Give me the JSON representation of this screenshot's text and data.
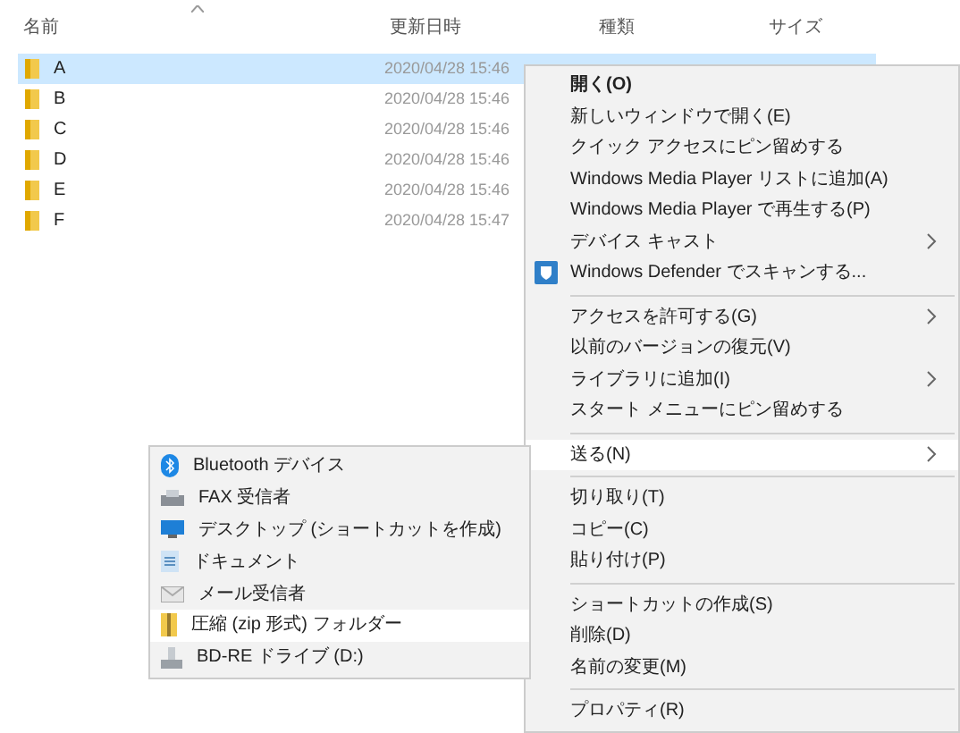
{
  "file_list": {
    "columns": [
      "名前",
      "更新日時",
      "種類",
      "サイズ"
    ],
    "rows": [
      {
        "name": "A",
        "modified": "2020/04/28 15:46",
        "selected": true
      },
      {
        "name": "B",
        "modified": "2020/04/28 15:46",
        "selected": false
      },
      {
        "name": "C",
        "modified": "2020/04/28 15:46",
        "selected": false
      },
      {
        "name": "D",
        "modified": "2020/04/28 15:46",
        "selected": false
      },
      {
        "name": "E",
        "modified": "2020/04/28 15:46",
        "selected": false
      },
      {
        "name": "F",
        "modified": "2020/04/28 15:47",
        "selected": false
      }
    ]
  },
  "context_menu": {
    "items": [
      {
        "kind": "item",
        "label": "開く(O)",
        "bold": true,
        "submenu": false,
        "selected": false
      },
      {
        "kind": "item",
        "label": "新しいウィンドウで開く(E)",
        "bold": false,
        "submenu": false,
        "selected": false
      },
      {
        "kind": "item",
        "label": "クイック アクセスにピン留めする",
        "bold": false,
        "submenu": false,
        "selected": false
      },
      {
        "kind": "item",
        "label": "Windows Media Player リストに追加(A)",
        "bold": false,
        "submenu": false,
        "selected": false
      },
      {
        "kind": "item",
        "label": "Windows Media Player で再生する(P)",
        "bold": false,
        "submenu": false,
        "selected": false
      },
      {
        "kind": "item",
        "label": "デバイス キャスト",
        "bold": false,
        "submenu": true,
        "selected": false
      },
      {
        "kind": "shield-item",
        "label": "Windows Defender でスキャンする...",
        "bold": false,
        "submenu": false,
        "selected": false
      },
      {
        "kind": "separator"
      },
      {
        "kind": "item",
        "label": "アクセスを許可する(G)",
        "bold": false,
        "submenu": true,
        "selected": false
      },
      {
        "kind": "item",
        "label": "以前のバージョンの復元(V)",
        "bold": false,
        "submenu": false,
        "selected": false
      },
      {
        "kind": "item",
        "label": "ライブラリに追加(I)",
        "bold": false,
        "submenu": true,
        "selected": false
      },
      {
        "kind": "item",
        "label": "スタート メニューにピン留めする",
        "bold": false,
        "submenu": false,
        "selected": false
      },
      {
        "kind": "separator"
      },
      {
        "kind": "item",
        "label": "送る(N)",
        "bold": false,
        "submenu": true,
        "selected": true
      },
      {
        "kind": "separator"
      },
      {
        "kind": "item",
        "label": "切り取り(T)",
        "bold": false,
        "submenu": false,
        "selected": false
      },
      {
        "kind": "item",
        "label": "コピー(C)",
        "bold": false,
        "submenu": false,
        "selected": false
      },
      {
        "kind": "item",
        "label": "貼り付け(P)",
        "bold": false,
        "submenu": false,
        "selected": false
      },
      {
        "kind": "separator"
      },
      {
        "kind": "item",
        "label": "ショートカットの作成(S)",
        "bold": false,
        "submenu": false,
        "selected": false
      },
      {
        "kind": "item",
        "label": "削除(D)",
        "bold": false,
        "submenu": false,
        "selected": false
      },
      {
        "kind": "item",
        "label": "名前の変更(M)",
        "bold": false,
        "submenu": false,
        "selected": false
      },
      {
        "kind": "separator"
      },
      {
        "kind": "item",
        "label": "プロパティ(R)",
        "bold": false,
        "submenu": false,
        "selected": false
      }
    ]
  },
  "send_to_menu": {
    "items": [
      {
        "kind": "bluetooth",
        "label": "Bluetooth デバイス",
        "selected": false
      },
      {
        "kind": "fax",
        "label": "FAX 受信者",
        "selected": false
      },
      {
        "kind": "desktop",
        "label": "デスクトップ (ショートカットを作成)",
        "selected": false
      },
      {
        "kind": "document",
        "label": "ドキュメント",
        "selected": false
      },
      {
        "kind": "mail",
        "label": "メール受信者",
        "selected": false
      },
      {
        "kind": "zip",
        "label": "圧縮 (zip 形式) フォルダー",
        "selected": true
      },
      {
        "kind": "drive",
        "label": "BD-RE ドライブ (D:)",
        "selected": false
      }
    ]
  }
}
